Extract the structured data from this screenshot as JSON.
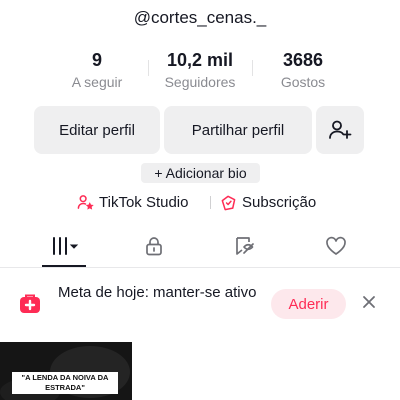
{
  "profile": {
    "username": "@cortes_cenas._"
  },
  "stats": [
    {
      "value": "9",
      "label": "A seguir"
    },
    {
      "value": "10,2 mil",
      "label": "Seguidores"
    },
    {
      "value": "3686",
      "label": "Gostos"
    }
  ],
  "actions": {
    "edit_profile": "Editar perfil",
    "share_profile": "Partilhar perfil",
    "add_friend_icon": "add-user-icon"
  },
  "bio": {
    "add_bio": "+ Adicionar bio"
  },
  "links": {
    "studio": "TikTok Studio",
    "subscription": "Subscrição"
  },
  "tabs": [
    {
      "name": "videos-grid",
      "icon": "grid-icon",
      "selected": true
    },
    {
      "name": "private",
      "icon": "lock-icon",
      "selected": false
    },
    {
      "name": "reposts",
      "icon": "repost-icon",
      "selected": false
    },
    {
      "name": "liked",
      "icon": "heart-icon",
      "selected": false
    }
  ],
  "banner": {
    "text": "Meta de hoje: manter-se ativo",
    "join_label": "Aderir"
  },
  "videos": [
    {
      "caption": "\"A LENDA DA NOIVA DA ESTRADA\""
    }
  ],
  "colors": {
    "accent": "#fe2c55",
    "text": "#161823",
    "muted": "#8a8b91",
    "button_bg": "#efeff0"
  }
}
